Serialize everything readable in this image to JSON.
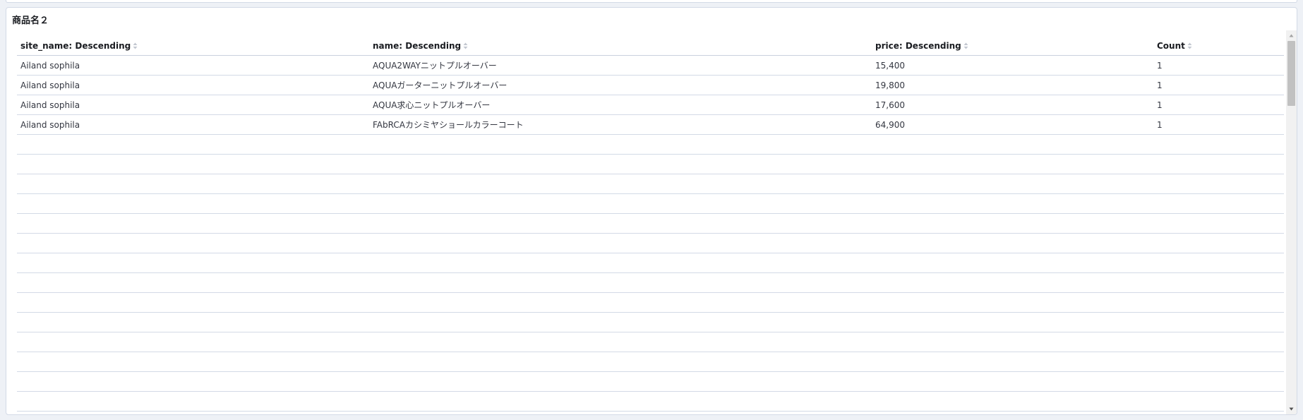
{
  "panel": {
    "title": "商品名２"
  },
  "table": {
    "columns": [
      {
        "label": "site_name: Descending"
      },
      {
        "label": "name: Descending"
      },
      {
        "label": "price: Descending"
      },
      {
        "label": "Count"
      }
    ],
    "rows": [
      [
        "Ailand sophila",
        "AQUA2WAYニットプルオーバー",
        "15,400",
        "1"
      ],
      [
        "Ailand sophila",
        "AQUAガーターニットプルオーバー",
        "19,800",
        "1"
      ],
      [
        "Ailand sophila",
        "AQUA求心ニットプルオーバー",
        "17,600",
        "1"
      ],
      [
        "Ailand sophila",
        "FAbRCAカシミヤショールカラーコート",
        "64,900",
        "1"
      ]
    ]
  },
  "scrollbar": {
    "up_icon": "triangle-up-icon",
    "down_icon": "triangle-down-icon"
  },
  "colors": {
    "border": "#d3dae6",
    "text": "#343741",
    "header_text": "#1a1c21",
    "background": "#eef1f6"
  }
}
